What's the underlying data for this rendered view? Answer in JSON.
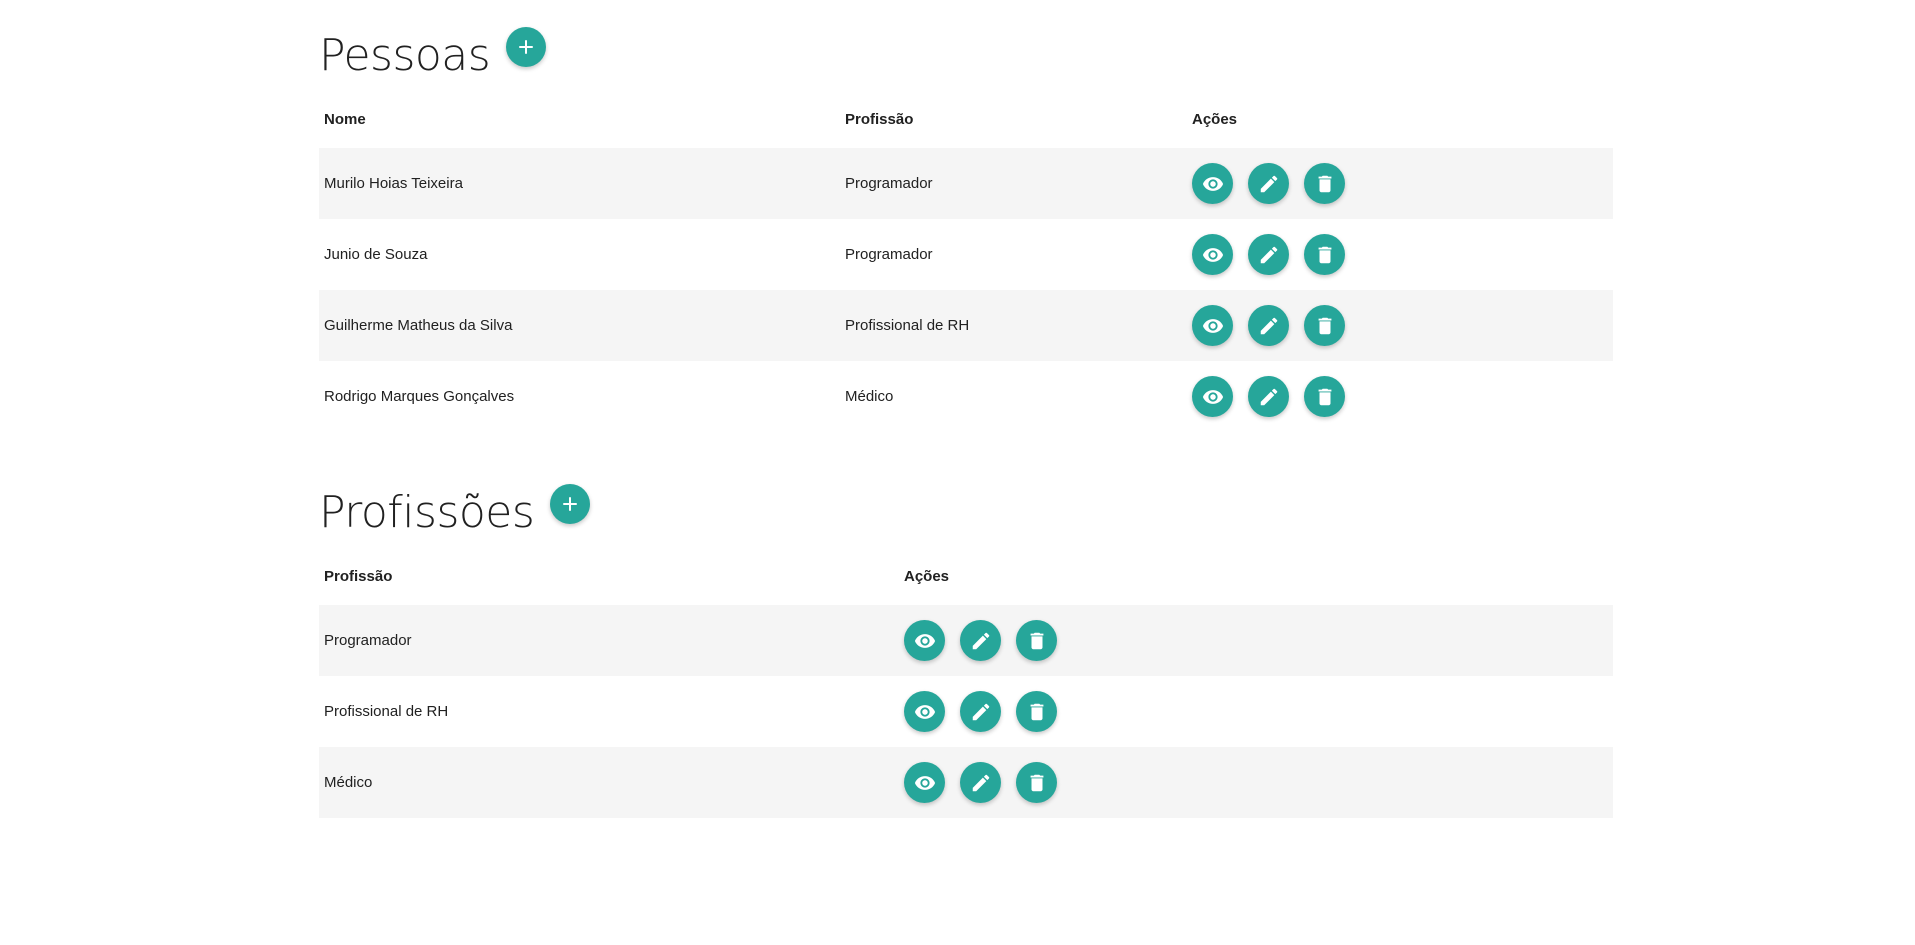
{
  "pessoas": {
    "title": "Pessoas",
    "columns": [
      "Nome",
      "Profissão",
      "Ações"
    ],
    "rows": [
      {
        "nome": "Murilo Hoias Teixeira",
        "profissao": "Programador"
      },
      {
        "nome": "Junio de Souza",
        "profissao": "Programador"
      },
      {
        "nome": "Guilherme Matheus da Silva",
        "profissao": "Profissional de RH"
      },
      {
        "nome": "Rodrigo Marques Gonçalves",
        "profissao": "Médico"
      }
    ]
  },
  "profissoes": {
    "title": "Profissões",
    "columns": [
      "Profissão",
      "Ações"
    ],
    "rows": [
      {
        "profissao": "Programador"
      },
      {
        "profissao": "Profissional de RH"
      },
      {
        "profissao": "Médico"
      }
    ]
  },
  "icons": {
    "add": "plus-icon",
    "view": "eye-icon",
    "edit": "pencil-icon",
    "delete": "trash-icon"
  },
  "colors": {
    "accent": "#26a69a",
    "row_stripe": "#f5f5f5",
    "text": "#212121"
  }
}
